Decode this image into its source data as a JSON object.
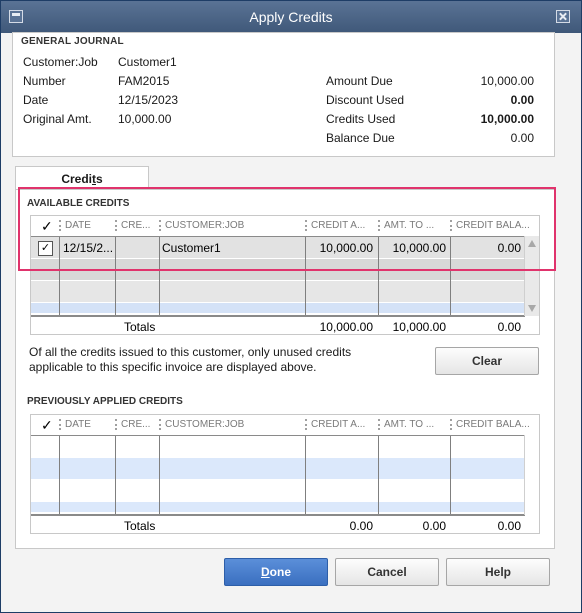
{
  "window": {
    "title": "Apply Credits"
  },
  "journal": {
    "heading": "GENERAL JOURNAL",
    "customer_job_label": "Customer:Job",
    "customer_job": "Customer1",
    "number_label": "Number",
    "number": "FAM2015",
    "date_label": "Date",
    "date": "12/15/2023",
    "original_amt_label": "Original Amt.",
    "original_amt": "10,000.00",
    "amount_due_label": "Amount Due",
    "amount_due": "10,000.00",
    "discount_used_label": "Discount Used",
    "discount_used": "0.00",
    "credits_used_label": "Credits Used",
    "credits_used": "10,000.00",
    "balance_due_label": "Balance Due",
    "balance_due": "0.00"
  },
  "tab": {
    "label_pre": "Credi",
    "label_u": "t",
    "label_post": "s"
  },
  "columns": {
    "check": "✓",
    "date": "DATE",
    "cre": "CRE...",
    "customer": "CUSTOMER:JOB",
    "credit_amt": "CREDIT A...",
    "amt_to": "AMT. TO ...",
    "credit_bal": "CREDIT BALA..."
  },
  "available": {
    "heading": "AVAILABLE CREDITS",
    "row": {
      "checked": "✓",
      "date": "12/15/2...",
      "customer": "Customer1",
      "credit_amt": "10,000.00",
      "amt_to": "10,000.00",
      "credit_bal": "0.00"
    },
    "totals_label": "Totals",
    "totals_credit_amt": "10,000.00",
    "totals_amt_to": "10,000.00",
    "totals_credit_bal": "0.00"
  },
  "note": "Of all the credits issued to this customer, only unused credits applicable to this specific invoice are displayed above.",
  "clear_label": "Clear",
  "previous": {
    "heading": "PREVIOUSLY APPLIED CREDITS",
    "totals_label": "Totals",
    "totals_credit_amt": "0.00",
    "totals_amt_to": "0.00",
    "totals_credit_bal": "0.00"
  },
  "buttons": {
    "done_pre": "",
    "done_u": "D",
    "done_post": "one",
    "cancel": "Cancel",
    "help": "Help"
  },
  "colors": {
    "title_bar": "#4a6385",
    "highlight": "#e0336c",
    "primary": "#3a6fc0",
    "row_alt": "#dbe8fb"
  }
}
